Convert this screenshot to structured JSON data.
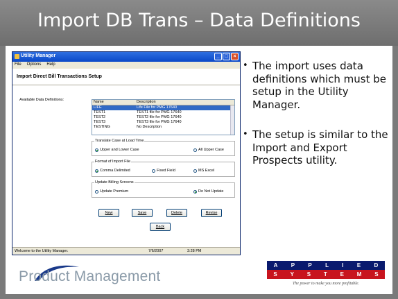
{
  "slide": {
    "title": "Import DB Trans – Data Definitions",
    "bullets": [
      "The import uses data definitions which must be setup in the Utility Manager.",
      "The setup is similar to the Import and Export Prospects utility."
    ],
    "footer_text": "Product Management",
    "logo_row1": [
      "A",
      "P",
      "P",
      "L",
      "I",
      "E",
      "D"
    ],
    "logo_row2": [
      "S",
      "Y",
      "S",
      "T",
      "E",
      "M",
      "S"
    ],
    "tagline": "The power to make you more profitable."
  },
  "window": {
    "title": "Utility Manager",
    "menu": [
      "File",
      "Options",
      "Help"
    ],
    "heading": "Import Direct Bill Transactions Setup",
    "available_label": "Available Data Definitions:",
    "list_headers": [
      "Name",
      "Description"
    ],
    "list_rows": [
      {
        "name": "LIFE",
        "desc": "Life File for PMG 17640",
        "selected": true
      },
      {
        "name": "TEST1",
        "desc": "TEST1 file for PMG 17640",
        "selected": false
      },
      {
        "name": "TEST2",
        "desc": "TEST2 file for PMG 17640",
        "selected": false
      },
      {
        "name": "TEST3",
        "desc": "TEST3 file for PMG 17640",
        "selected": false
      },
      {
        "name": "TESTING",
        "desc": "No Description",
        "selected": false
      }
    ],
    "translate_group": {
      "title": "Translate Case at Load Time",
      "option1": "Upper and Lower Case",
      "option2": "All Upper Case"
    },
    "format_group": {
      "title": "Format of Import File",
      "option1": "Comma Delimited",
      "option2": "Fixed Field",
      "option3": "MS Excel"
    },
    "billing_group": {
      "title": "Update Billing Screens",
      "option1": "Update Premium",
      "option2": "Do Not Update"
    },
    "buttons": {
      "new": "New",
      "save": "Save",
      "delete": "Delete",
      "revise": "Revise",
      "back": "Back"
    },
    "status": {
      "message": "Welcome to the Utility Manager.",
      "date": "7/6/2007",
      "time": "3:28 PM"
    }
  }
}
